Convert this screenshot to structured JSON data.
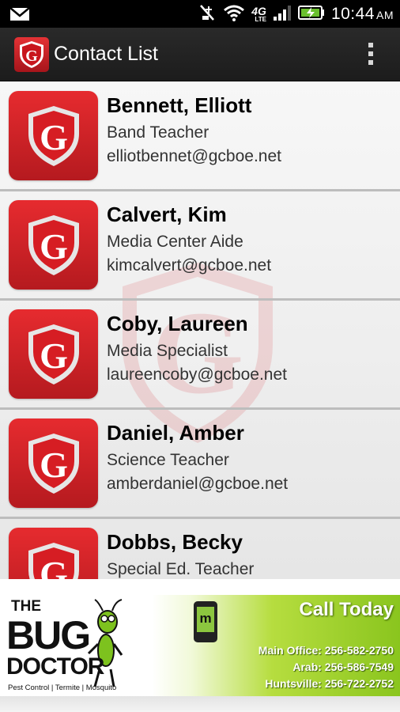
{
  "status_bar": {
    "time": "10:44",
    "ampm": "AM",
    "network": "4G",
    "network_sub": "LTE",
    "icons": [
      "mail-icon",
      "mute-icon",
      "wifi-icon",
      "signal-icon",
      "battery-charging-icon"
    ]
  },
  "app_bar": {
    "title": "Contact List",
    "logo_letter": "G",
    "menu_icon": "overflow-menu-icon"
  },
  "contacts": [
    {
      "name": "Bennett, Elliott",
      "role": "Band Teacher",
      "email": "elliotbennet@gcboe.net"
    },
    {
      "name": "Calvert, Kim",
      "role": "Media Center Aide",
      "email": "kimcalvert@gcboe.net"
    },
    {
      "name": "Coby, Laureen",
      "role": "Media Specialist",
      "email": "laureencoby@gcboe.net"
    },
    {
      "name": "Daniel, Amber",
      "role": "Science Teacher",
      "email": "amberdaniel@gcboe.net"
    },
    {
      "name": "Dobbs, Becky",
      "role": "Special Ed. Teacher",
      "email": ""
    }
  ],
  "ad": {
    "logo_the": "THE",
    "logo_bug": "BUG",
    "logo_doctor": "DOCTOR",
    "tagline": "Pest Control | Termite | Mosquito",
    "phone_letter": "m",
    "headline": "Call Today",
    "main_office": "Main Office: 256-582-2750",
    "arab": "Arab: 256-586-7549",
    "huntsville": "Huntsville: 256-722-2752"
  },
  "colors": {
    "brand_red": "#d81f26",
    "action_bar": "#222222",
    "ad_green": "#8ac51e"
  }
}
